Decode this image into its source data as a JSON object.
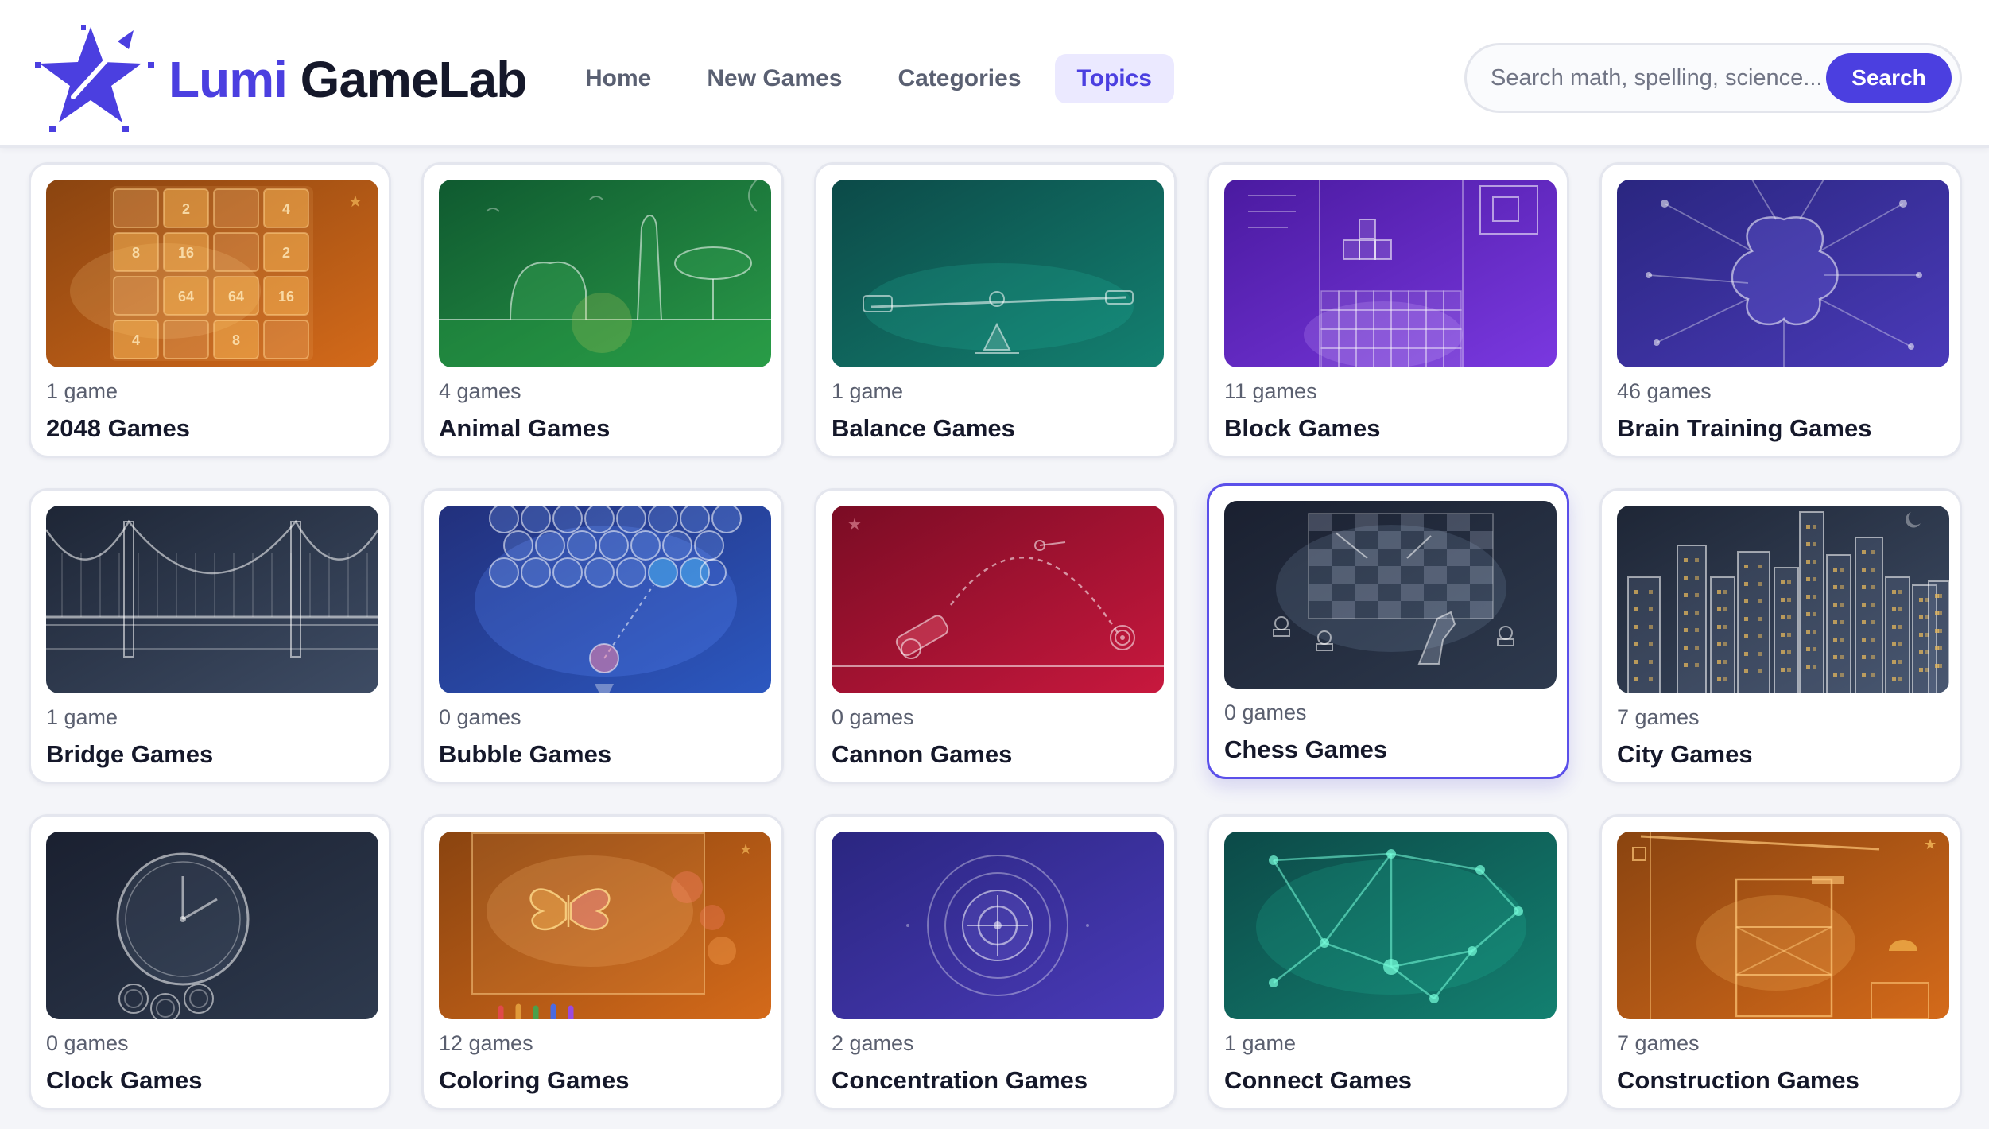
{
  "header": {
    "brand_part1": "Lumi",
    "brand_part2": "GameLab",
    "nav": [
      {
        "label": "Home",
        "active": false
      },
      {
        "label": "New Games",
        "active": false
      },
      {
        "label": "Categories",
        "active": false
      },
      {
        "label": "Topics",
        "active": true
      }
    ],
    "search": {
      "placeholder": "Search math, spelling, science...",
      "button_label": "Search"
    }
  },
  "colors": {
    "accent": "#4b3fe0",
    "active_nav_bg": "#ebe9ff"
  },
  "cards": [
    {
      "title": "2048 Games",
      "count": "1 game",
      "theme": "orange",
      "art": "2048-grid"
    },
    {
      "title": "Animal Games",
      "count": "4 games",
      "theme": "green",
      "art": "animal-scene"
    },
    {
      "title": "Balance Games",
      "count": "1 game",
      "theme": "teal",
      "art": "seesaw"
    },
    {
      "title": "Block Games",
      "count": "11 games",
      "theme": "purple",
      "art": "falling-blocks"
    },
    {
      "title": "Brain Training Games",
      "count": "46 games",
      "theme": "indigo",
      "art": "brain-network"
    },
    {
      "title": "Bridge Games",
      "count": "1 game",
      "theme": "slate",
      "art": "suspension-bridge"
    },
    {
      "title": "Bubble Games",
      "count": "0 games",
      "theme": "blue",
      "art": "bubble-shooter"
    },
    {
      "title": "Cannon Games",
      "count": "0 games",
      "theme": "red",
      "art": "cannon"
    },
    {
      "title": "Chess Games",
      "count": "0 games",
      "theme": "dark",
      "art": "chessboard",
      "hover": true
    },
    {
      "title": "City Games",
      "count": "7 games",
      "theme": "slate",
      "art": "city-skyline"
    },
    {
      "title": "Clock Games",
      "count": "0 games",
      "theme": "dark",
      "art": "clock"
    },
    {
      "title": "Coloring Games",
      "count": "12 games",
      "theme": "orange",
      "art": "butterfly"
    },
    {
      "title": "Concentration Games",
      "count": "2 games",
      "theme": "indigo",
      "art": "target"
    },
    {
      "title": "Connect Games",
      "count": "1 game",
      "theme": "teal",
      "art": "dot-network"
    },
    {
      "title": "Construction Games",
      "count": "7 games",
      "theme": "orange",
      "art": "crane"
    }
  ]
}
